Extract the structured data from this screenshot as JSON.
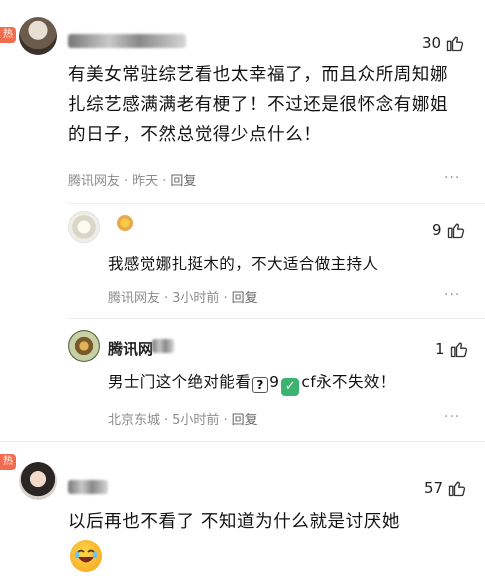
{
  "hot_badge": "热",
  "comments": [
    {
      "likes": "30",
      "text": "有美女常驻综艺看也太幸福了，而且众所周知娜扎综艺感满满老有梗了！不过还是很怀念有娜姐的日子，不然总觉得少点什么！",
      "source": "腾讯网友",
      "time": "昨天",
      "reply": "回复",
      "more": "···"
    },
    {
      "likes": "9",
      "text": "我感觉娜扎挺木的，不大适合做主持人",
      "source": "腾讯网友",
      "time": "3小时前",
      "reply": "回复",
      "more": "···"
    },
    {
      "name_partial": "腾讯网",
      "likes": "1",
      "text_a": "男士门这个绝对能看",
      "emoji_q": "?",
      "text_b": "9",
      "emoji_check": "✓",
      "text_c": "cf永不失效！",
      "source": "北京东城",
      "time": "5小时前",
      "reply": "回复",
      "more": "···"
    },
    {
      "likes": "57",
      "text": "以后再也不看了 不知道为什么就是讨厌她"
    }
  ],
  "icons": {
    "like": "thumbs-up-icon",
    "more": "more-dots-icon"
  }
}
